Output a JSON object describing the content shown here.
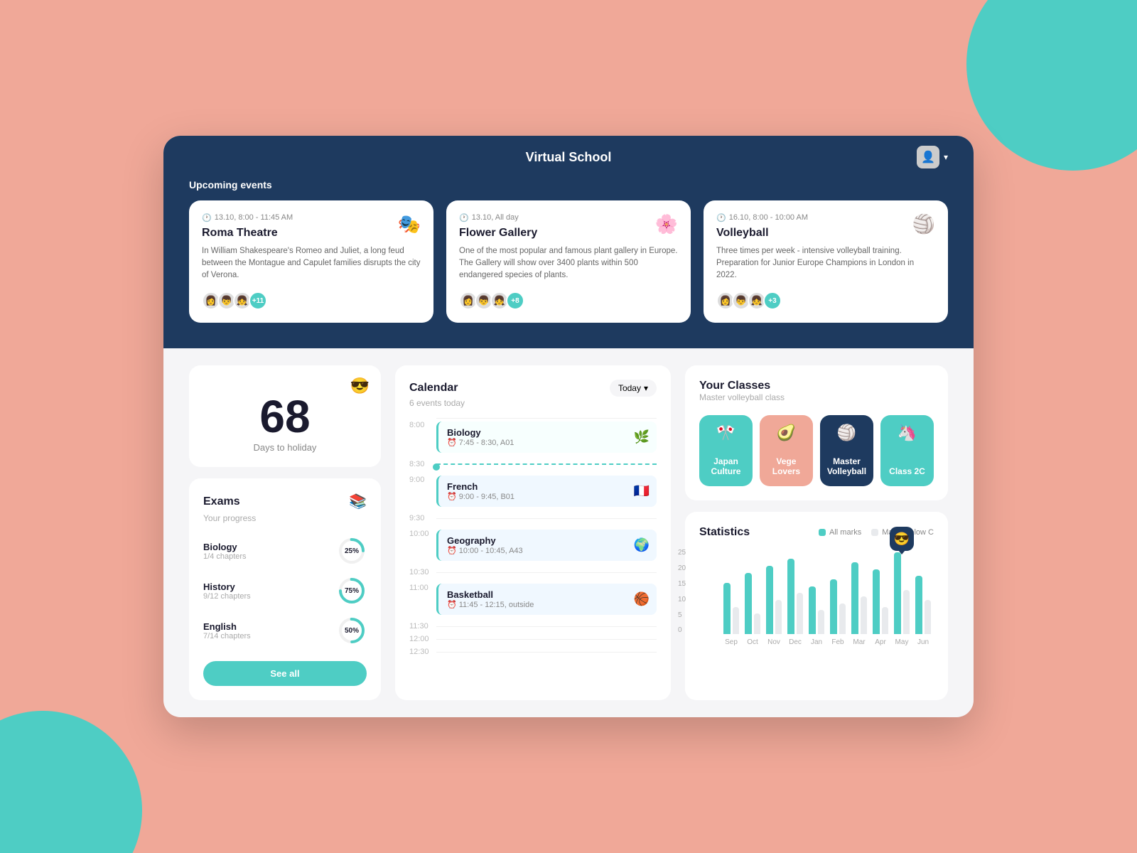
{
  "header": {
    "title": "Virtual School",
    "avatar_emoji": "👤",
    "chevron": "▾"
  },
  "events": {
    "section_label": "Upcoming events",
    "cards": [
      {
        "time": "13.10, 8:00 - 11:45 AM",
        "title": "Roma Theatre",
        "desc": "In William Shakespeare's Romeo and Juliet, a long feud between the Montague and Capulet families disrupts the city of Verona.",
        "icon": "🎭",
        "attendees": [
          "👩",
          "👦",
          "👧"
        ],
        "extra_count": "+11"
      },
      {
        "time": "13.10, All day",
        "title": "Flower Gallery",
        "desc": "One of the most popular and famous plant gallery in Europe. The Gallery will show over 3400 plants within 500 endangered species of plants.",
        "icon": "🌸",
        "attendees": [
          "👩",
          "👦",
          "👧"
        ],
        "extra_count": "+8"
      },
      {
        "time": "16.10, 8:00 - 10:00 AM",
        "title": "Volleyball",
        "desc": "Three times per week - intensive volleyball training. Preparation for Junior Europe Champions in London in 2022.",
        "icon": "🏐",
        "attendees": [
          "👩",
          "👦",
          "👧"
        ],
        "extra_count": "+3"
      }
    ]
  },
  "days_card": {
    "emoji": "😎",
    "number": "68",
    "label": "Days to holiday"
  },
  "exams": {
    "title": "Exams",
    "subtitle": "Your progress",
    "icon": "📚",
    "items": [
      {
        "name": "Biology",
        "chapters": "1/4 chapters",
        "pct": 25,
        "color": "#4ecdc4"
      },
      {
        "name": "History",
        "chapters": "9/12 chapters",
        "pct": 75,
        "color": "#4ecdc4"
      },
      {
        "name": "English",
        "chapters": "7/14 chapters",
        "pct": 50,
        "color": "#4ecdc4"
      }
    ],
    "see_all_label": "See all"
  },
  "calendar": {
    "title": "Calendar",
    "subtitle": "6 events today",
    "today_label": "Today",
    "events": [
      {
        "time_label": "8:00",
        "name": "Biology",
        "time_detail": "⏰ 7:45 - 8:30, A01",
        "icon": "🌿",
        "is_current": false
      },
      {
        "time_label": "9:00",
        "name": "French",
        "time_detail": "⏰ 9:00 - 9:45, B01",
        "icon": "🇫🇷",
        "is_current": true
      },
      {
        "time_label": "10:00",
        "name": "Geography",
        "time_detail": "⏰ 10:00 - 10:45, A43",
        "icon": "🌍",
        "is_current": false
      },
      {
        "time_label": "11:00",
        "name": "Basketball",
        "time_detail": "⏰ 11:45 - 12:15, outside",
        "icon": "🏀",
        "is_current": false
      }
    ],
    "time_slots": [
      "8:00",
      "8:30",
      "9:00",
      "9:30",
      "10:00",
      "10:30",
      "11:00",
      "11:30",
      "12:00",
      "12:30"
    ]
  },
  "classes": {
    "title": "Your Classes",
    "subtitle": "Master volleyball class",
    "items": [
      {
        "label": "Japan Culture",
        "icon": "🎌",
        "color": "#4ecdc4"
      },
      {
        "label": "Vege Lovers",
        "icon": "🥑",
        "color": "#f0a898"
      },
      {
        "label": "Master Volleyball",
        "icon": "🏐",
        "color": "#1e3a5f"
      },
      {
        "label": "Class 2C",
        "icon": "🦄",
        "color": "#4ecdc4"
      }
    ]
  },
  "statistics": {
    "title": "Statistics",
    "legend_all": "All marks",
    "legend_below": "Marks below C",
    "tooltip_emoji": "😎",
    "labels": [
      "Sep",
      "Oct",
      "Nov",
      "Dec",
      "Jan",
      "Feb",
      "Mar",
      "Apr",
      "May",
      "Jun"
    ],
    "bars": [
      {
        "green": 15,
        "gray": 8
      },
      {
        "green": 18,
        "gray": 6
      },
      {
        "green": 20,
        "gray": 10
      },
      {
        "green": 22,
        "gray": 12
      },
      {
        "green": 14,
        "gray": 7
      },
      {
        "green": 16,
        "gray": 9
      },
      {
        "green": 21,
        "gray": 11
      },
      {
        "green": 19,
        "gray": 8
      },
      {
        "green": 24,
        "gray": 13
      },
      {
        "green": 17,
        "gray": 10
      }
    ],
    "y_labels": [
      "25",
      "20",
      "15",
      "10",
      "5",
      "0"
    ],
    "tooltip_index": 8
  }
}
